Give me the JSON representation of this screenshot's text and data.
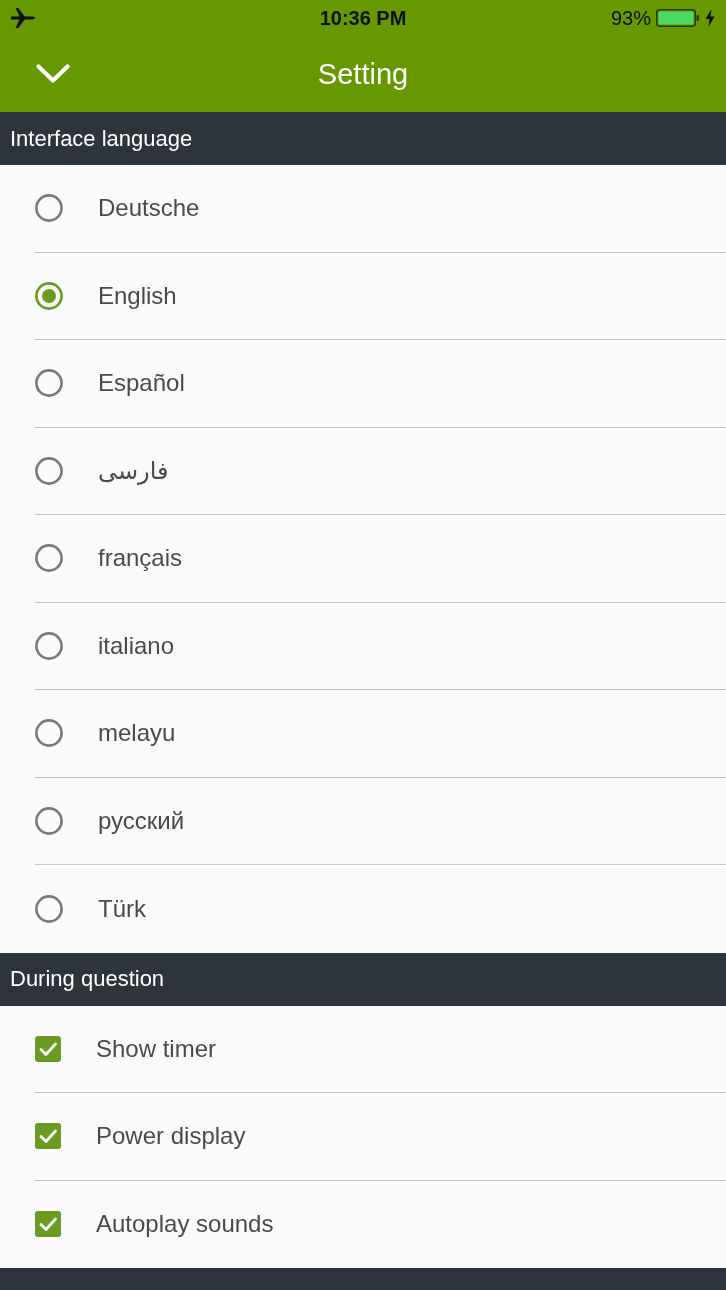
{
  "status_bar": {
    "time": "10:36 PM",
    "battery": "93%"
  },
  "header": {
    "title": "Setting"
  },
  "sections": [
    {
      "title": "Interface language",
      "kind": "radio",
      "items": [
        {
          "label": "Deutsche",
          "selected": false
        },
        {
          "label": "English",
          "selected": true
        },
        {
          "label": "Español",
          "selected": false
        },
        {
          "label": "فارسی",
          "selected": false
        },
        {
          "label": "français",
          "selected": false
        },
        {
          "label": "italiano",
          "selected": false
        },
        {
          "label": "melayu",
          "selected": false
        },
        {
          "label": "русский",
          "selected": false
        },
        {
          "label": "Türk",
          "selected": false
        }
      ]
    },
    {
      "title": "During question",
      "kind": "checkbox",
      "items": [
        {
          "label": "Show timer",
          "checked": true
        },
        {
          "label": "Power display",
          "checked": true
        },
        {
          "label": "Autoplay sounds",
          "checked": true
        }
      ]
    }
  ]
}
